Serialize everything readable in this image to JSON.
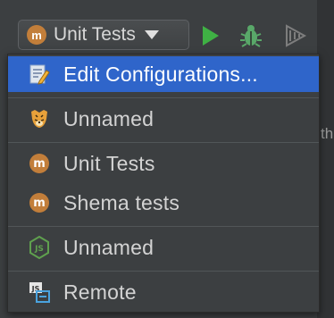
{
  "toolbar": {
    "run_config": {
      "badge_letter": "m",
      "label": "Unit Tests",
      "badge_color": "#c27e3a"
    },
    "buttons": [
      {
        "name": "run",
        "icon": "play-icon",
        "color": "#3fb144"
      },
      {
        "name": "debug",
        "icon": "bug-icon",
        "color": "#59a869"
      },
      {
        "name": "coverage",
        "icon": "coverage-icon",
        "color": "#8f8f8f"
      }
    ]
  },
  "background_peek": {
    "text": "th"
  },
  "menu": {
    "selected_color": "#2f65ca",
    "items": [
      {
        "label": "Edit Configurations...",
        "icon": "edit-configurations-icon",
        "selected": true
      },
      {
        "label": "Unnamed",
        "icon": "tiger-icon",
        "selected": false
      },
      {
        "label": "Unit Tests",
        "icon": "mocha-m-icon",
        "selected": false
      },
      {
        "label": "Shema tests",
        "icon": "mocha-m-icon",
        "selected": false
      },
      {
        "label": "Unnamed",
        "icon": "nodejs-icon",
        "selected": false
      },
      {
        "label": "Remote",
        "icon": "remote-js-icon",
        "selected": false
      }
    ]
  }
}
